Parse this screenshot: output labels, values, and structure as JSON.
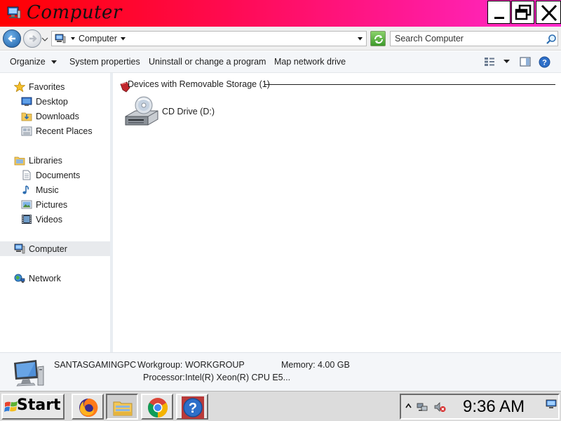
{
  "window": {
    "title": "Computer"
  },
  "address": {
    "path_label": "Computer",
    "search_placeholder": "Search Computer"
  },
  "toolbar": {
    "organize_label": "Organize",
    "system_properties_label": "System properties",
    "uninstall_label": "Uninstall or change a program",
    "map_drive_label": "Map network drive"
  },
  "sidebar": {
    "favorites": {
      "label": "Favorites",
      "icon": "star-icon"
    },
    "favorites_items": [
      {
        "label": "Desktop",
        "icon": "desktop-icon"
      },
      {
        "label": "Downloads",
        "icon": "downloads-folder-icon"
      },
      {
        "label": "Recent Places",
        "icon": "recent-places-icon"
      }
    ],
    "libraries": {
      "label": "Libraries",
      "icon": "libraries-icon"
    },
    "libraries_items": [
      {
        "label": "Documents",
        "icon": "documents-icon"
      },
      {
        "label": "Music",
        "icon": "music-icon"
      },
      {
        "label": "Pictures",
        "icon": "pictures-icon"
      },
      {
        "label": "Videos",
        "icon": "videos-icon"
      }
    ],
    "computer": {
      "label": "Computer",
      "icon": "computer-icon",
      "selected": true
    },
    "network": {
      "label": "Network",
      "icon": "network-icon"
    }
  },
  "content": {
    "group_title": "Devices with Removable Storage (1)",
    "drives": [
      {
        "label": "CD Drive (D:)",
        "icon": "cd-drive-icon"
      }
    ]
  },
  "details": {
    "computer_name": "SANTASGAMINGPC",
    "workgroup_label": "Workgroup:",
    "workgroup_value": "WORKGROUP",
    "memory_label": "Memory:",
    "memory_value": "4.00 GB",
    "processor_label": "Processor:",
    "processor_value": "Intel(R) Xeon(R) CPU E5..."
  },
  "taskbar": {
    "start_label": "Start",
    "apps": [
      {
        "name": "firefox-icon"
      },
      {
        "name": "file-explorer-icon",
        "active": true
      },
      {
        "name": "chrome-icon"
      },
      {
        "name": "help-icon"
      }
    ],
    "clock": "9:36 AM"
  },
  "colors": {
    "titlebar_start": "#ff0000",
    "titlebar_end": "#ff2dd0",
    "selection": "#e8eaed",
    "taskbar": "#dcdcdc"
  }
}
